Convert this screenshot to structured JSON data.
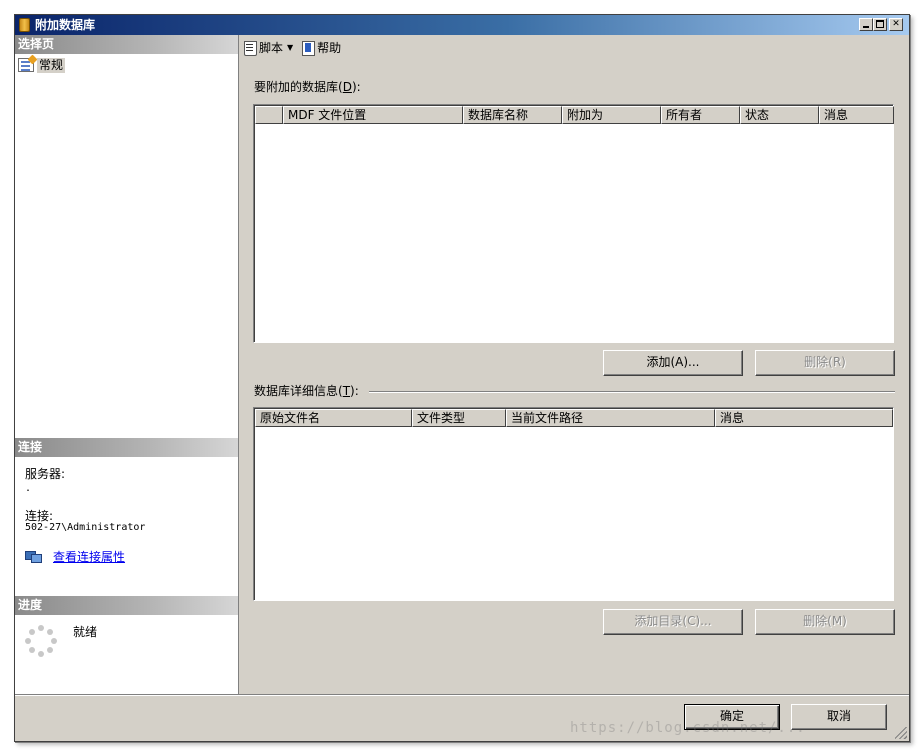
{
  "window": {
    "title": "附加数据库"
  },
  "left": {
    "select_page_header": "选择页",
    "pages": [
      {
        "label": "常规"
      }
    ],
    "connection_header": "连接",
    "server_label": "服务器:",
    "server_value": ".",
    "connection_label": "连接:",
    "connection_value": "502-27\\Administrator",
    "view_props_link": "查看连接属性",
    "progress_header": "进度",
    "progress_status": "就绪"
  },
  "toolbar": {
    "script_label": "脚本",
    "help_label": "帮助"
  },
  "attach": {
    "label": "要附加的数据库",
    "mnemonic": "D",
    "columns": [
      "",
      "MDF 文件位置",
      "数据库名称",
      "附加为",
      "所有者",
      "状态",
      "消息"
    ],
    "rows": [],
    "add_button": "添加(A)...",
    "remove_button": "删除(R)"
  },
  "details": {
    "label": "数据库详细信息",
    "mnemonic": "T",
    "columns": [
      "原始文件名",
      "文件类型",
      "当前文件路径",
      "消息"
    ],
    "rows": [],
    "add_catalog_button": "添加目录(C)...",
    "remove_button": "删除(M)"
  },
  "footer": {
    "ok_button": "确定",
    "cancel_button": "取消"
  },
  "watermark": "https://blog.csdn.net/...",
  "colors": {
    "dialog_bg": "#d4d0c8",
    "title_gradient_start": "#0a246a",
    "link": "#0000ee"
  }
}
